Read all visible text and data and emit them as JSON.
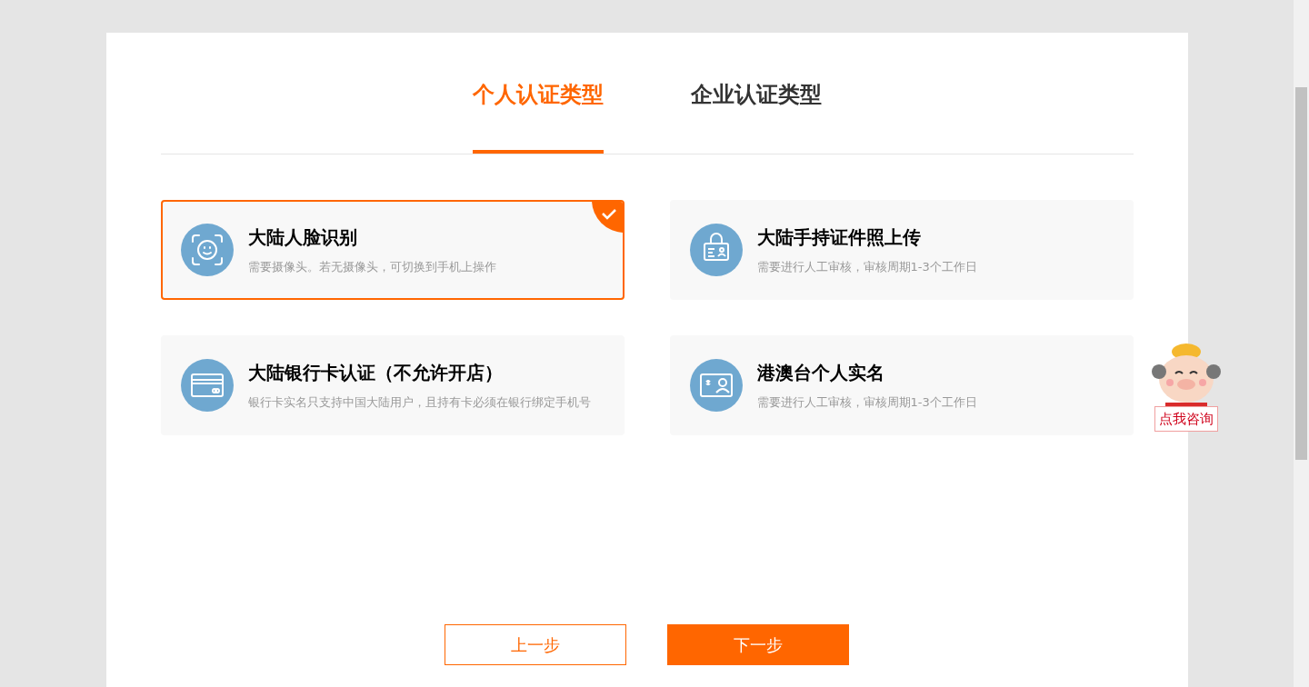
{
  "tabs": [
    {
      "label": "个人认证类型",
      "selected": true
    },
    {
      "label": "企业认证类型",
      "selected": false
    }
  ],
  "options": [
    {
      "kind": "face",
      "title": "大陆人脸识别",
      "description": "需要摄像头。若无摄像头，可切换到手机上操作",
      "selected": true
    },
    {
      "kind": "id-hold",
      "title": "大陆手持证件照上传",
      "description": "需要进行人工审核，审核周期1-3个工作日",
      "selected": false
    },
    {
      "kind": "bank-card",
      "title": "大陆银行卡认证（不允许开店）",
      "description": "银行卡实名只支持中国大陆用户，且持有卡必须在银行绑定手机号",
      "selected": false
    },
    {
      "kind": "hk-id",
      "title": "港澳台个人实名",
      "description": "需要进行人工审核，审核周期1-3个工作日",
      "selected": false
    }
  ],
  "buttons": [
    {
      "kind": "outline",
      "label": "上一步"
    },
    {
      "kind": "primary",
      "label": "下一步"
    }
  ],
  "consult_widget": {
    "label": "点我咨询"
  }
}
